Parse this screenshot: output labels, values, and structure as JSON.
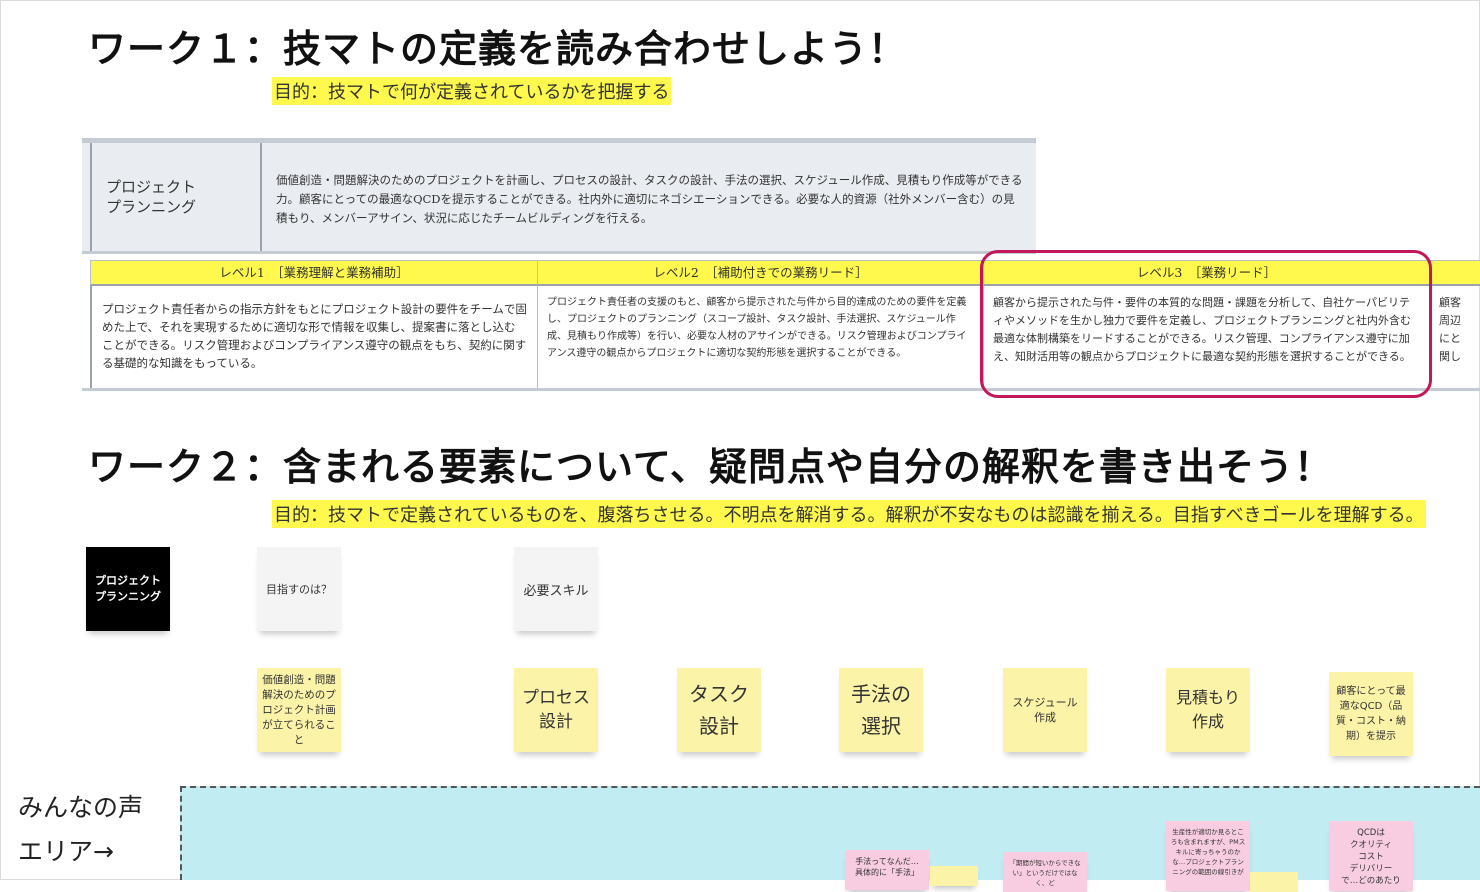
{
  "work1": {
    "heading": "ワーク１：技マトの定義を読み合わせしよう！",
    "purpose": "目的：技マトで何が定義されているかを把握する"
  },
  "definition": {
    "name": "プロジェクト\nプランニング",
    "description": "価値創造・問題解決のためのプロジェクトを計画し、プロセスの設計、タスクの設計、手法の選択、スケジュール作成、見積もり作成等ができる力。顧客にとっての最適なQCDを提示することができる。社内外に適切にネゴシエーションできる。必要な人的資源（社外メンバー含む）の見積もり、メンバーアサイン、状況に応じたチームビルディングを行える。"
  },
  "levels": [
    {
      "header": "レベル1　［業務理解と業務補助］",
      "body": "プロジェクト責任者からの指示方針をもとにプロジェクト設計の要件をチームで固めた上で、それを実現するために適切な形で情報を収集し、提案書に落とし込むことができる。リスク管理およびコンプライアンス遵守の観点をもち、契約に関する基礎的な知識をもっている。"
    },
    {
      "header": "レベル2　［補助付きでの業務リード］",
      "body": "プロジェクト責任者の支援のもと、顧客から提示された与件から目的達成のための要件を定義し、プロジェクトのプランニング（スコープ設計、タスク設計、手法選択、スケジュール作成、見積もり作成等）を行い、必要な人材のアサインができる。リスク管理およびコンプライアンス遵守の観点からプロジェクトに適切な契約形態を選択することができる。"
    },
    {
      "header": "レベル3　［業務リード］",
      "body": "顧客から提示された与件・要件の本質的な問題・課題を分析して、自社ケーパビリティやメソッドを生かし独力で要件を定義し、プロジェクトプランニングと社内外含む最適な体制構築をリードすることができる。リスク管理、コンプライアンス遵守に加え、知財活用等の観点からプロジェクトに最適な契約形態を選択することができる。"
    },
    {
      "header": "",
      "body": "顧客\n周辺\nにと\n関し"
    }
  ],
  "work2": {
    "heading": "ワーク２：含まれる要素について、疑問点や自分の解釈を書き出そう！",
    "purpose": "目的：技マトで定義されているものを、腹落ちさせる。不明点を解消する。解釈が不安なものは認識を揃える。目指すべきゴールを理解する。"
  },
  "stickies_top": [
    {
      "text": "プロジェクト\nプランニング",
      "color": "black"
    },
    {
      "text": "目指すのは？",
      "color": "white"
    },
    {
      "text": "必要スキル",
      "color": "white"
    }
  ],
  "stickies_elements": [
    "価値創造・問題解決のためのプロジェクト計画が立てられること",
    "プロセス\n設計",
    "タスク\n設計",
    "手法の\n選択",
    "スケジュール\n作成",
    "見積もり\n作成",
    "顧客にとって最適なQCD（品質・コスト・納期）を提示"
  ],
  "voice": {
    "label": "みんなの声\nエリア→",
    "notes": [
      "手法ってなんだ…\n具体的に「手法」",
      "「期間が短いからできない」というだけではなく、ど",
      "生産性が適切か見るところも含まれますが、PMスキルに寄っちゃうのかな…プロジェクトプランニングの範囲の線引きが",
      "QCDは\nクオリティ\nコスト\nデリバリー\nで…どのあたり"
    ]
  },
  "colors": {
    "highlight": "#fff94d",
    "sticky_yellow": "#fbf3a8",
    "sticky_pink": "#f8cde1",
    "voice_area": "#c1ecf2",
    "focus_border": "#c2185b"
  }
}
